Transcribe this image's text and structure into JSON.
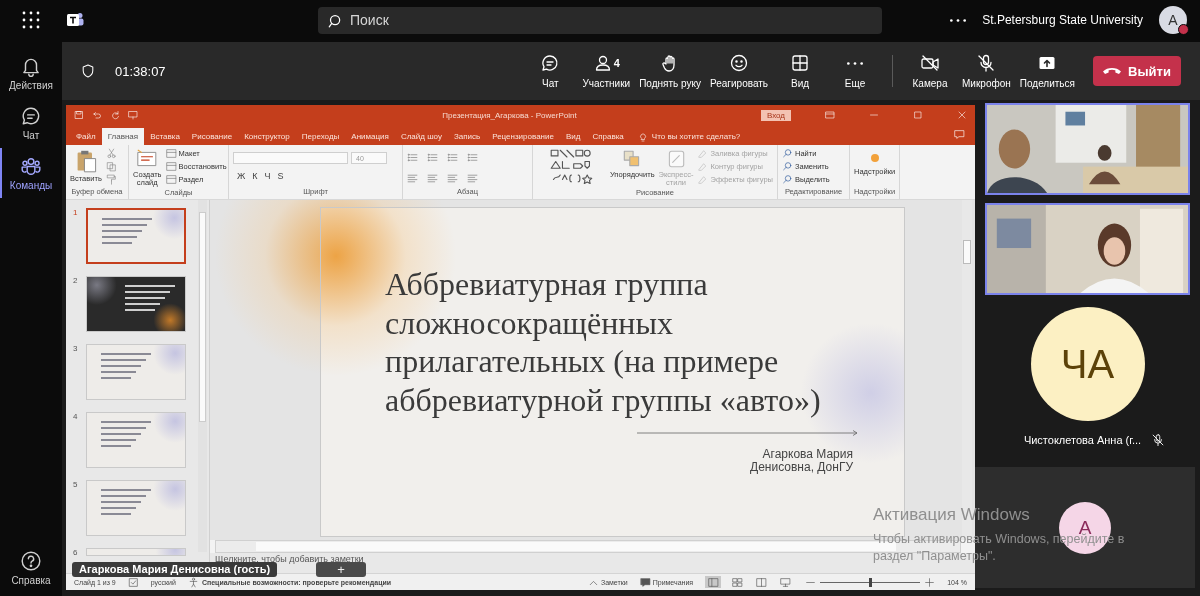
{
  "top_bar": {
    "search": {
      "placeholder": "Поиск"
    },
    "organization": "St.Petersburg State University",
    "avatar": {
      "initial": "A"
    }
  },
  "rail": [
    {
      "kind": "bell",
      "label": "Действия",
      "selected": false
    },
    {
      "kind": "chat",
      "label": "Чат",
      "selected": false
    },
    {
      "kind": "teams",
      "label": "Команды",
      "selected": true
    }
  ],
  "rail_bottom": {
    "kind": "help",
    "label": "Справка"
  },
  "meeting_bar": {
    "timer": "01:38:07",
    "actions": [
      {
        "kind": "chat",
        "label": "Чат"
      },
      {
        "kind": "people",
        "label": "Участники",
        "count": "4"
      },
      {
        "kind": "hand",
        "label": "Поднять руку"
      },
      {
        "kind": "smile",
        "label": "Реагировать"
      },
      {
        "kind": "grid",
        "label": "Вид"
      },
      {
        "kind": "more",
        "label": "Еще"
      }
    ],
    "devices": [
      {
        "kind": "camera",
        "label": "Камера",
        "off": true
      },
      {
        "kind": "mic",
        "label": "Микрофон",
        "off": true
      },
      {
        "kind": "share",
        "label": "Поделиться",
        "off": false
      }
    ],
    "leave": "Выйти"
  },
  "powerpoint": {
    "title": "Презентация_Агаркова - PowerPoint",
    "sign_in": "Вход",
    "tabs": [
      {
        "label": "Файл",
        "selected": false
      },
      {
        "label": "Главная",
        "selected": true
      },
      {
        "label": "Вставка",
        "selected": false
      },
      {
        "label": "Рисование",
        "selected": false
      },
      {
        "label": "Конструктор",
        "selected": false
      },
      {
        "label": "Переходы",
        "selected": false
      },
      {
        "label": "Анимация",
        "selected": false
      },
      {
        "label": "Слайд шоу",
        "selected": false
      },
      {
        "label": "Запись",
        "selected": false
      },
      {
        "label": "Рецензирование",
        "selected": false
      },
      {
        "label": "Вид",
        "selected": false
      },
      {
        "label": "Справка",
        "selected": false
      }
    ],
    "tell_me": "Что вы хотите сделать?",
    "ribbon": [
      {
        "kind": "clipboard",
        "label": "Буфер обмена",
        "paste": "Вставить"
      },
      {
        "kind": "slides",
        "label": "Слайды",
        "new_slide": "Создать\nслайд",
        "commands": [
          "Макет",
          "Восстановить",
          "Раздел"
        ]
      },
      {
        "kind": "font",
        "label": "Шрифт",
        "size": "40",
        "styles": [
          "Ж",
          "К",
          "Ч",
          "S"
        ]
      },
      {
        "kind": "paragraph",
        "label": "Абзац"
      },
      {
        "kind": "drawing",
        "label": "Рисование",
        "arrange": "Упорядочить",
        "quick_styles": {
          "label": "Экспресс-\nстили",
          "disabled": true
        },
        "format": [
          {
            "label": "Заливка фигуры",
            "disabled": true
          },
          {
            "label": "Контур фигуры",
            "disabled": true
          },
          {
            "label": "Эффекты фигуры",
            "disabled": true
          }
        ]
      },
      {
        "kind": "editing",
        "label": "Редактирование",
        "commands": [
          "Найти",
          "Заменить",
          "Выделить"
        ]
      },
      {
        "kind": "addins",
        "label": "Надстройки",
        "button": "Надстройки"
      }
    ],
    "slides": [
      {
        "number": "1",
        "kind": "light",
        "selected": true
      },
      {
        "number": "2",
        "kind": "dark",
        "selected": false
      },
      {
        "number": "3",
        "kind": "light",
        "selected": false
      },
      {
        "number": "4",
        "kind": "light",
        "selected": false
      },
      {
        "number": "5",
        "kind": "light",
        "selected": false
      },
      {
        "number": "6",
        "kind": "light",
        "selected": false
      }
    ],
    "slide": {
      "title": "Аббревиатурная группа\nсложносокращённых\nприлагательных (на примере\nаббревиатурной группы «авто»)",
      "author": "Агаркова Мария\nДенисовна, ДонГУ"
    },
    "notes_placeholder": "Щелкните, чтобы добавить заметки",
    "status_bar": {
      "slide": "Слайд 1 из 9",
      "language": "русский",
      "accessibility": "Специальные возможности: проверьте рекомендации",
      "notes": "Заметки",
      "comments": "Примечания",
      "zoom_slider": {
        "level": 0.5
      },
      "zoom": "104 %"
    }
  },
  "presenter_tag": "Агаркова Мария Денисовна (гость)",
  "overlay_button": "+",
  "participants": [
    {
      "kind": "video",
      "highlighted": true
    },
    {
      "kind": "video",
      "highlighted": true
    },
    {
      "kind": "avatar",
      "initials": "ЧА",
      "color": "#fcf0c3",
      "name": "Чистоклетова Анна (г...",
      "muted": true
    },
    {
      "kind": "avatar",
      "initials": "А",
      "color": "#f5d6e7"
    }
  ],
  "windows_activation": {
    "title": "Активация Windows",
    "message": "Чтобы активировать Windows, перейдите в\nраздел \"Параметры\"."
  }
}
